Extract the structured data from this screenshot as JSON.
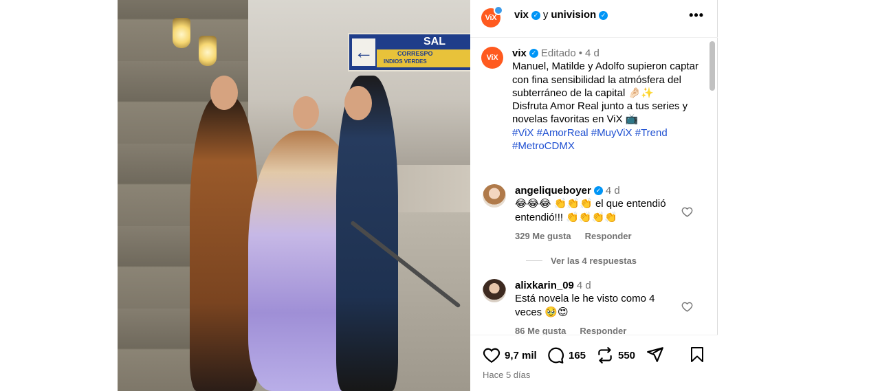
{
  "header": {
    "account": "vix",
    "connector": "y",
    "collab": "univision",
    "avatar_text": "ViX",
    "more_icon": "more-horizontal-icon"
  },
  "caption": {
    "avatar_text": "ViX",
    "username": "vix",
    "edited": "Editado",
    "dot": "•",
    "age": "4 d",
    "text_1": "Manuel, Matilde y Adolfo supieron captar con fina sensibilidad la atmósfera del subterráneo de la capital 🤌🏻✨",
    "text_2": "Disfruta Amor Real junto a tus series y novelas favoritas en ViX 📺",
    "hashtags": [
      "#ViX",
      "#AmorReal",
      "#MuyViX",
      "#Trend",
      "#MetroCDMX"
    ]
  },
  "comments": [
    {
      "username": "angeliqueboyer",
      "verified": true,
      "age": "4 d",
      "text": "😂😂😂 👏👏👏 el que entendió entendió!!! 👏👏👏👏",
      "likes": "329 Me gusta",
      "reply": "Responder",
      "view_replies": "Ver las 4 respuestas"
    },
    {
      "username": "alixkarin_09",
      "verified": false,
      "age": "4 d",
      "text": "Está novela le he visto como 4 veces 🥹😍",
      "likes": "86 Me gusta",
      "reply": "Responder"
    }
  ],
  "actions": {
    "likes": "9,7 mil",
    "comments": "165",
    "reposts": "550",
    "posted": "Hace 5 días"
  },
  "media": {
    "sign_text": "SAL",
    "sign_line": "CORRESPO",
    "sign_line2": "INDIOS VERDES"
  },
  "colors": {
    "brand": "#ff5a1f",
    "verified": "#0095f6",
    "hashtag": "#1e4fd1",
    "muted": "#737373"
  }
}
